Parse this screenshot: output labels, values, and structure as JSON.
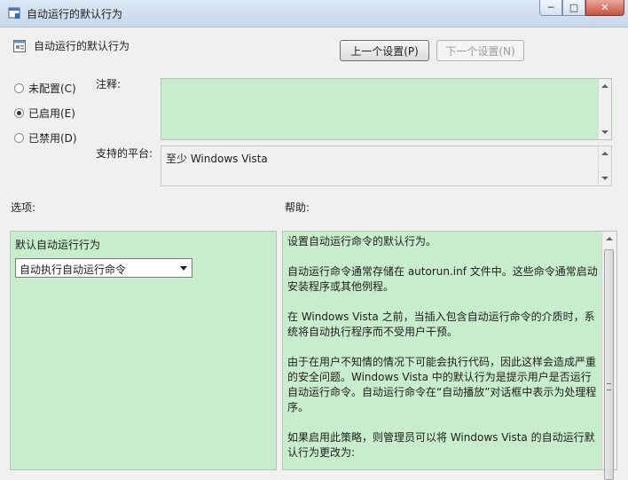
{
  "window": {
    "title": "自动运行的默认行为",
    "controls": {
      "minimize": "─",
      "maximize": "□",
      "close": "✕"
    }
  },
  "header": {
    "policy_name": "自动运行的默认行为",
    "prev_button": "上一个设置(P)",
    "next_button": "下一个设置(N)"
  },
  "state": {
    "options": [
      {
        "label": "未配置(C)",
        "checked": false
      },
      {
        "label": "已启用(E)",
        "checked": true
      },
      {
        "label": "已禁用(D)",
        "checked": false
      }
    ]
  },
  "comment": {
    "label": "注释:",
    "value": ""
  },
  "platform": {
    "label": "支持的平台:",
    "value": "至少 Windows Vista"
  },
  "options_section": {
    "label": "选项:",
    "field_label": "默认自动运行行为",
    "selected": "自动执行自动运行命令"
  },
  "help_section": {
    "label": "帮助:",
    "paragraphs": [
      "设置自动运行命令的默认行为。",
      "自动运行命令通常存储在 autorun.inf 文件中。这些命令通常启动安装程序或其他例程。",
      "在 Windows Vista 之前，当插入包含自动运行命令的介质时，系统将自动执行程序而不受用户干预。",
      "由于在用户不知情的情况下可能会执行代码，因此这样会造成严重的安全问题。Windows Vista 中的默认行为是提示用户是否运行自动运行命令。自动运行命令在“自动播放”对话框中表示为处理程序。",
      "如果启用此策略，则管理员可以将 Windows Vista 的自动运行默认行为更改为:"
    ]
  },
  "colors": {
    "panel_green": "#c7edcc",
    "window_bg": "#f0f0f0"
  }
}
